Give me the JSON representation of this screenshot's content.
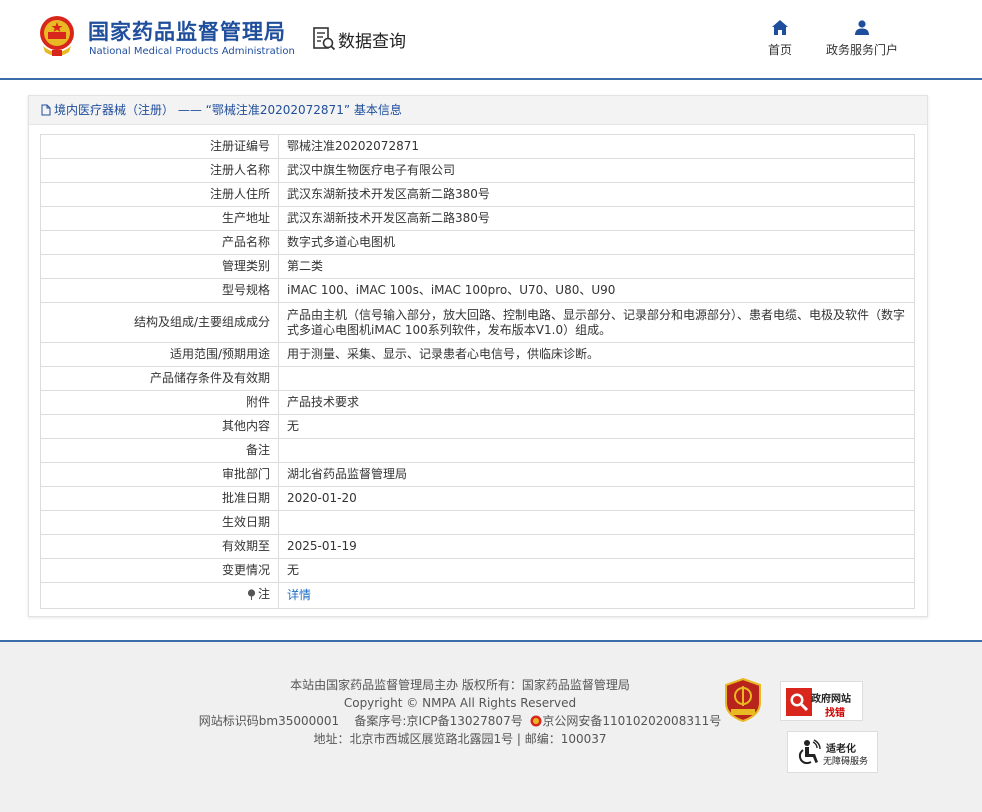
{
  "header": {
    "brand_cn": "国家药品监督管理局",
    "brand_en": "National Medical Products Administration",
    "query_label": "数据查询",
    "nav": [
      {
        "label": "首页",
        "icon": "home-icon"
      },
      {
        "label": "政务服务门户",
        "icon": "user-icon"
      }
    ]
  },
  "card": {
    "title": "境内医疗器械（注册） —— “鄂械注准20202072871” 基本信息"
  },
  "details": [
    {
      "key": "注册证编号",
      "value": "鄂械注准20202072871"
    },
    {
      "key": "注册人名称",
      "value": "武汉中旗生物医疗电子有限公司"
    },
    {
      "key": "注册人住所",
      "value": "武汉东湖新技术开发区高新二路380号"
    },
    {
      "key": "生产地址",
      "value": "武汉东湖新技术开发区高新二路380号"
    },
    {
      "key": "产品名称",
      "value": "数字式多道心电图机"
    },
    {
      "key": "管理类别",
      "value": "第二类"
    },
    {
      "key": "型号规格",
      "value": "iMAC 100、iMAC 100s、iMAC 100pro、U70、U80、U90"
    },
    {
      "key": "结构及组成/主要组成成分",
      "value": "产品由主机（信号输入部分，放大回路、控制电路、显示部分、记录部分和电源部分）、患者电缆、电极及软件（数字式多道心电图机iMAC 100系列软件，发布版本V1.0）组成。"
    },
    {
      "key": "适用范围/预期用途",
      "value": "用于测量、采集、显示、记录患者心电信号，供临床诊断。"
    },
    {
      "key": "产品储存条件及有效期",
      "value": ""
    },
    {
      "key": "附件",
      "value": "产品技术要求"
    },
    {
      "key": "其他内容",
      "value": "无"
    },
    {
      "key": "备注",
      "value": ""
    },
    {
      "key": "审批部门",
      "value": "湖北省药品监督管理局"
    },
    {
      "key": "批准日期",
      "value": "2020-01-20"
    },
    {
      "key": "生效日期",
      "value": ""
    },
    {
      "key": "有效期至",
      "value": "2025-01-19"
    },
    {
      "key": "变更情况",
      "value": "无"
    }
  ],
  "note_row": {
    "key": "注",
    "link": "详情"
  },
  "footer": {
    "line1": "本站由国家药品监督管理局主办 版权所有：国家药品监督管理局",
    "line2": "Copyright © NMPA All Rights Reserved",
    "site_id": "网站标识码bm35000001",
    "icp": "备案序号:京ICP备13027807号",
    "police": "京公网安备11010202008311号",
    "address": "地址：北京市西城区展览路北露园1号 | 邮编：100037",
    "badge_error_1": "政府网站",
    "badge_error_2": "找错",
    "badge_access_1": "适老化",
    "badge_access_2": "无障碍服务"
  },
  "colors": {
    "brand_blue": "#1f4e9c",
    "link_blue": "#1f6fc7",
    "divider_blue": "#3a6ea8"
  }
}
